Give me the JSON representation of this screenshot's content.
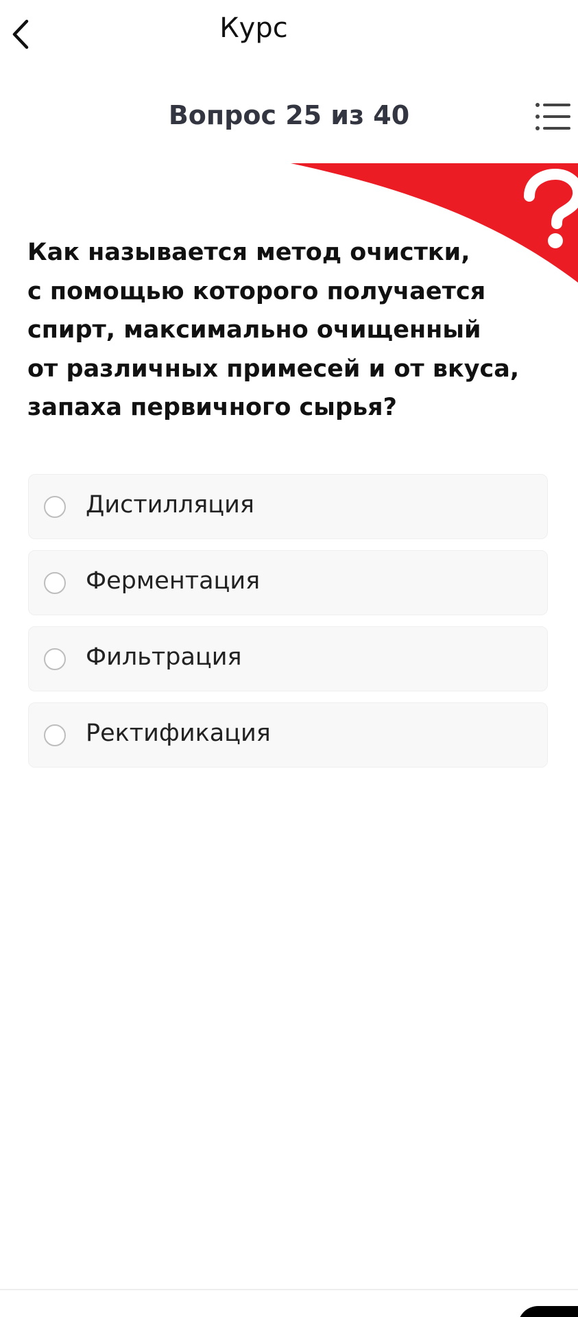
{
  "header": {
    "title": "Курс",
    "back_icon": "chevron-left-icon"
  },
  "question_header": {
    "counter": "Вопрос 25 из 40",
    "menu_icon": "list-menu-icon"
  },
  "banner": {
    "icon": "question-mark-icon",
    "color": "#ec1c24"
  },
  "question": {
    "lines": [
      "Как называется метод очистки,",
      "с помощью которого получается",
      "спирт, максимально очищенный",
      "от различных примесей и от вкуса,",
      "запаха первичного сырья?"
    ]
  },
  "answers": [
    {
      "label": "Дистилляция",
      "selected": false
    },
    {
      "label": "Ферментация",
      "selected": false
    },
    {
      "label": "Фильтрация",
      "selected": false
    },
    {
      "label": "Ректификация",
      "selected": false
    }
  ],
  "colors": {
    "accent": "#ec1c24",
    "text": "#111111",
    "counter_text": "#333640",
    "answer_bg": "#f8f8f8"
  }
}
